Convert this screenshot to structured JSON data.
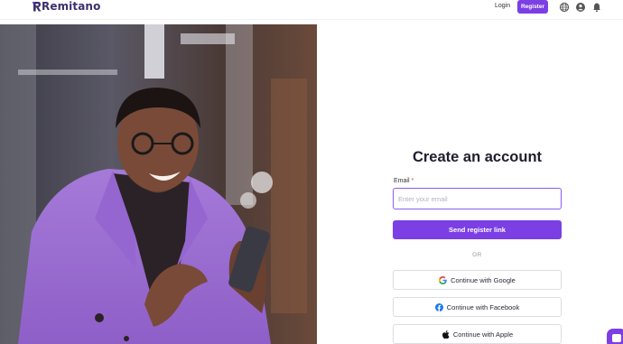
{
  "header": {
    "logo_text": "Remitano",
    "login_label": "Login",
    "register_label": "Register",
    "icons": [
      "globe-icon",
      "user-avatar-icon",
      "bell-icon"
    ]
  },
  "form": {
    "title": "Create an account",
    "email_label": "Email",
    "required_mark": "*",
    "email_value": "",
    "email_placeholder": "Enter your email",
    "submit_label": "Send register link",
    "divider": "OR",
    "google_label": "Continue with Google",
    "facebook_label": "Continue with Facebook",
    "apple_label": "Continue with Apple"
  },
  "colors": {
    "brand": "#7b3fe4",
    "logo": "#3d2f6e",
    "required": "#e5343a"
  }
}
